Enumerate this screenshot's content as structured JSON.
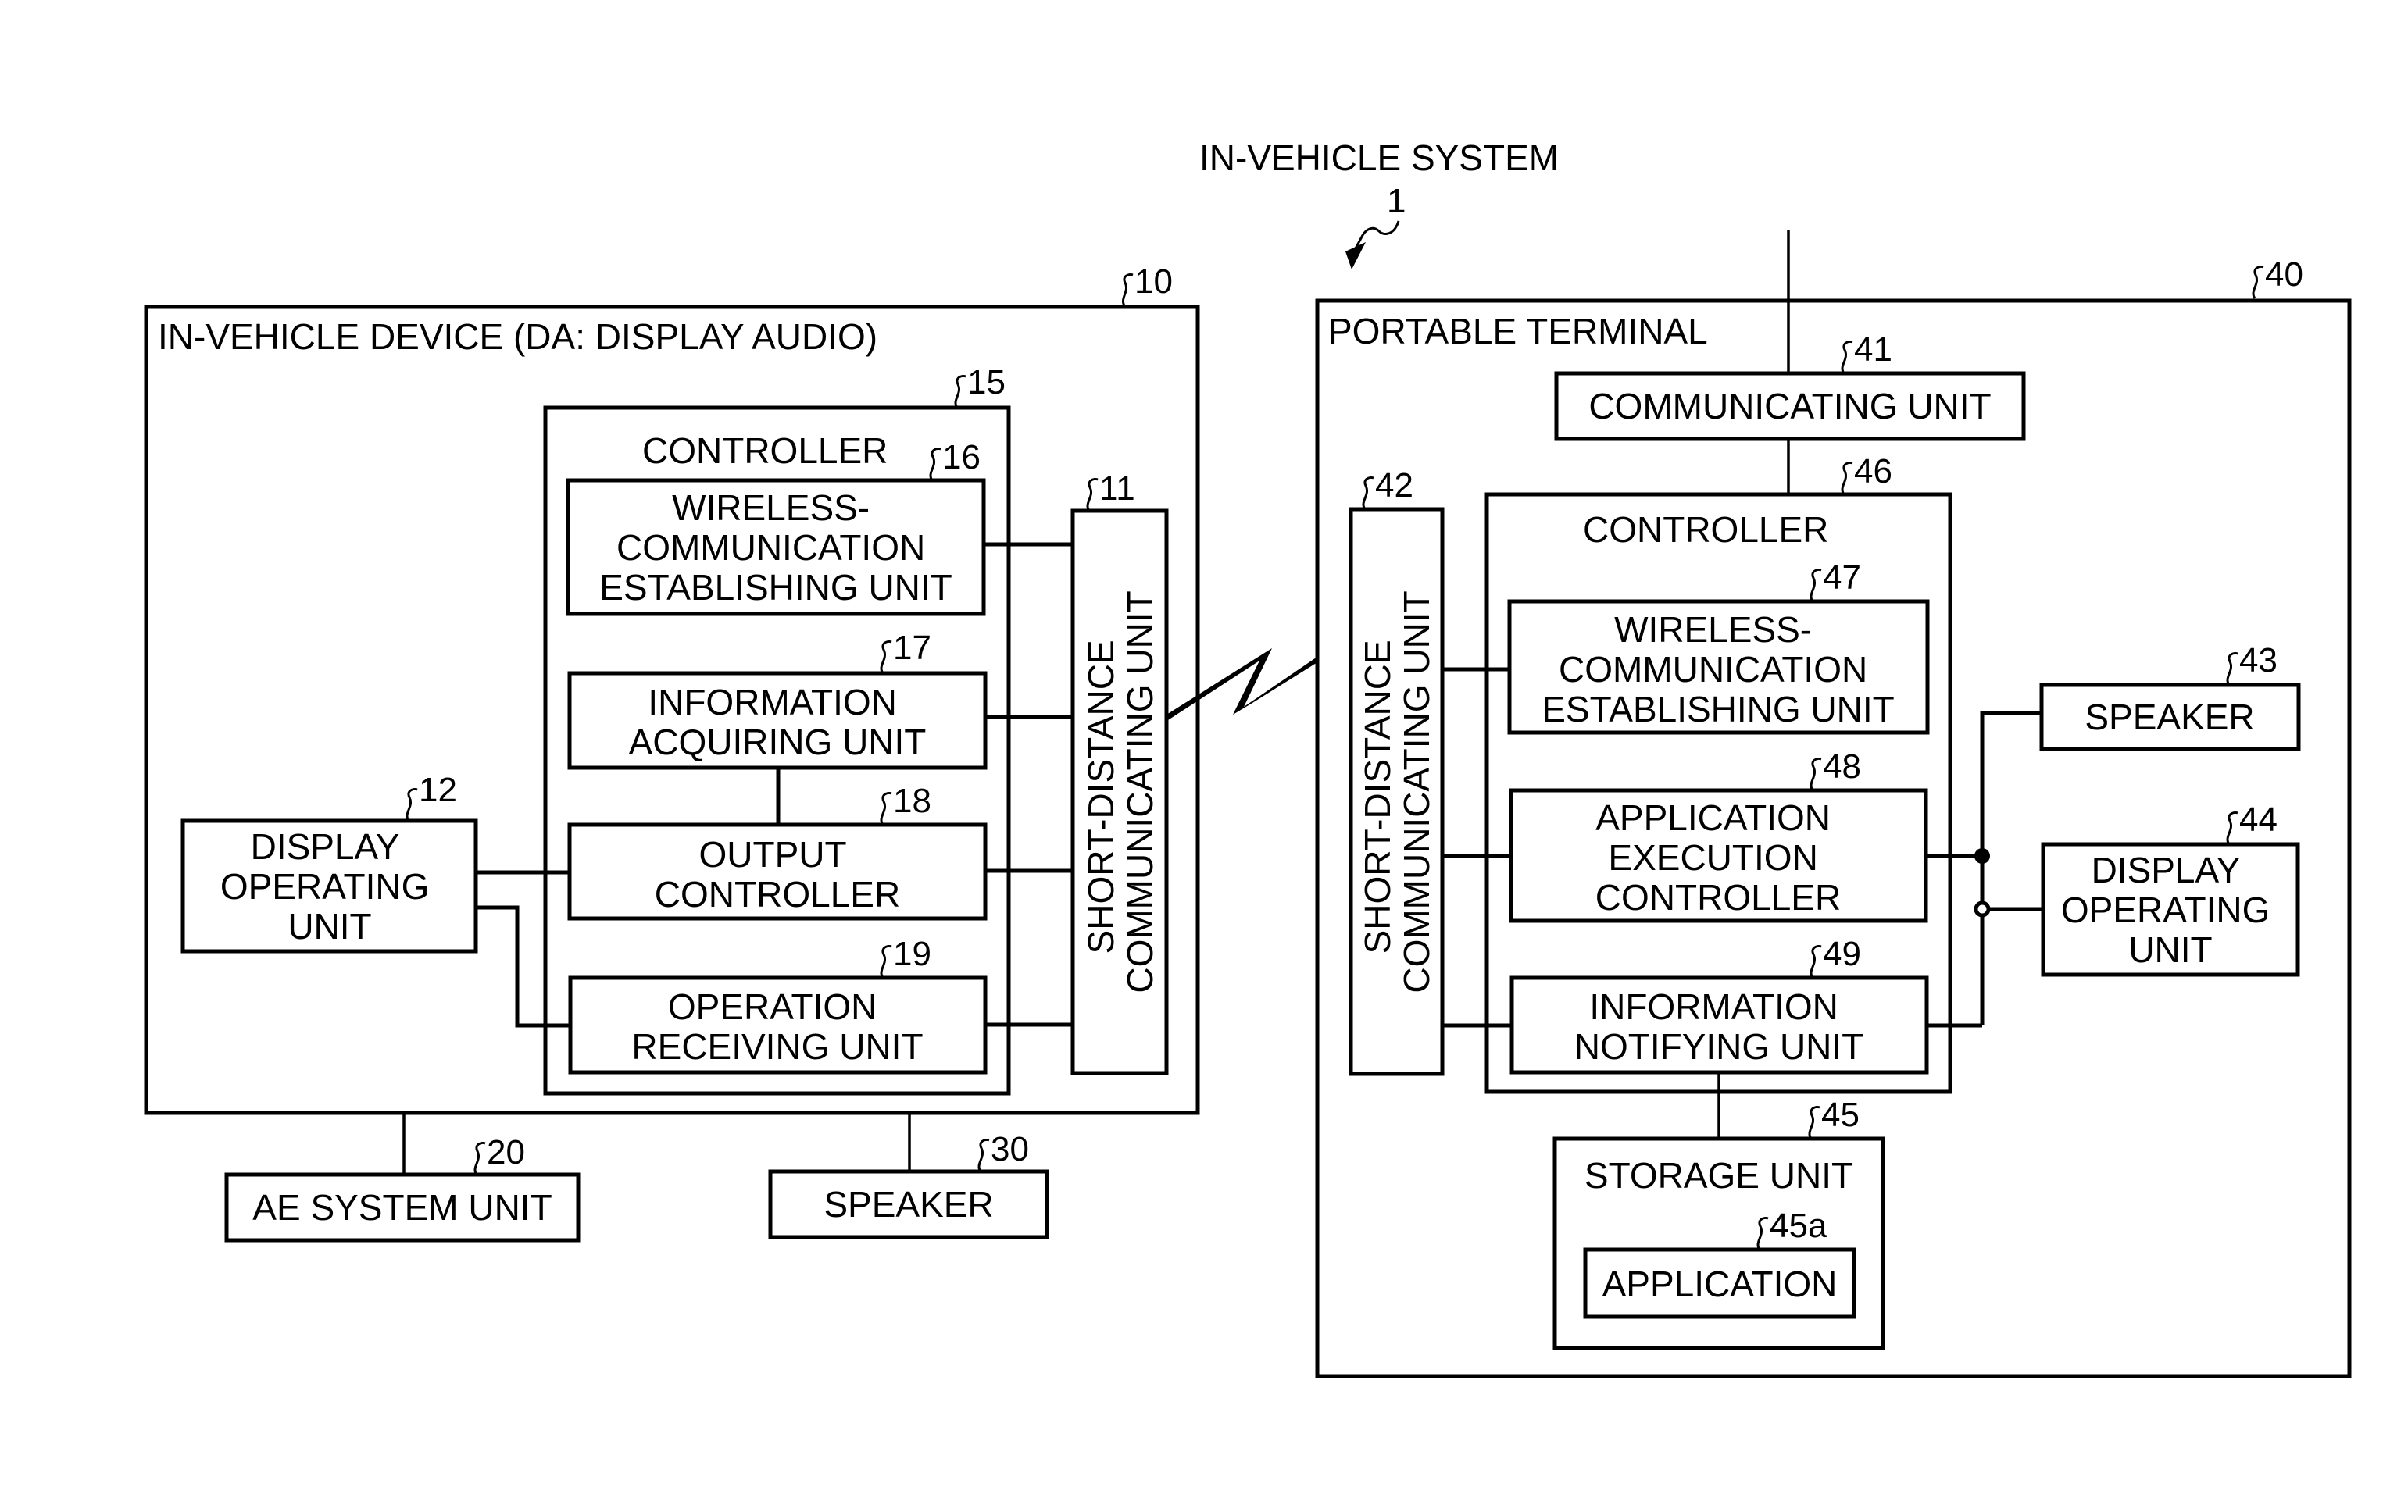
{
  "title": "IN-VEHICLE SYSTEM",
  "title_ref": "1",
  "in_vehicle_device": {
    "ref": "10",
    "label": "IN-VEHICLE DEVICE (DA: DISPLAY AUDIO)",
    "controller": {
      "ref": "15",
      "label": "CONTROLLER",
      "units": [
        {
          "ref": "16",
          "lines": [
            "WIRELESS-",
            "COMMUNICATION",
            "ESTABLISHING UNIT"
          ]
        },
        {
          "ref": "17",
          "lines": [
            "INFORMATION",
            "ACQUIRING UNIT"
          ]
        },
        {
          "ref": "18",
          "lines": [
            "OUTPUT",
            "CONTROLLER"
          ]
        },
        {
          "ref": "19",
          "lines": [
            "OPERATION",
            "RECEIVING UNIT"
          ]
        }
      ]
    },
    "short_distance_unit": {
      "ref": "11",
      "lines": [
        "SHORT-DISTANCE",
        "COMMUNICATING UNIT"
      ]
    },
    "display_operating_unit": {
      "ref": "12",
      "lines": [
        "DISPLAY",
        "OPERATING",
        "UNIT"
      ]
    }
  },
  "ae_system_unit": {
    "ref": "20",
    "label": "AE SYSTEM UNIT"
  },
  "vehicle_speaker": {
    "ref": "30",
    "label": "SPEAKER"
  },
  "portable_terminal": {
    "ref": "40",
    "label": "PORTABLE TERMINAL",
    "communicating_unit": {
      "ref": "41",
      "label": "COMMUNICATING UNIT"
    },
    "short_distance_unit": {
      "ref": "42",
      "lines": [
        "SHORT-DISTANCE",
        "COMMUNICATING UNIT"
      ]
    },
    "controller": {
      "ref": "46",
      "label": "CONTROLLER",
      "units": [
        {
          "ref": "47",
          "lines": [
            "WIRELESS-",
            "COMMUNICATION",
            "ESTABLISHING UNIT"
          ]
        },
        {
          "ref": "48",
          "lines": [
            "APPLICATION",
            "EXECUTION",
            "CONTROLLER"
          ]
        },
        {
          "ref": "49",
          "lines": [
            "INFORMATION",
            "NOTIFYING UNIT"
          ]
        }
      ]
    },
    "speaker": {
      "ref": "43",
      "label": "SPEAKER"
    },
    "display_operating_unit": {
      "ref": "44",
      "lines": [
        "DISPLAY",
        "OPERATING",
        "UNIT"
      ]
    },
    "storage_unit": {
      "ref": "45",
      "label": "STORAGE UNIT",
      "application": {
        "ref": "45a",
        "label": "APPLICATION"
      }
    }
  }
}
